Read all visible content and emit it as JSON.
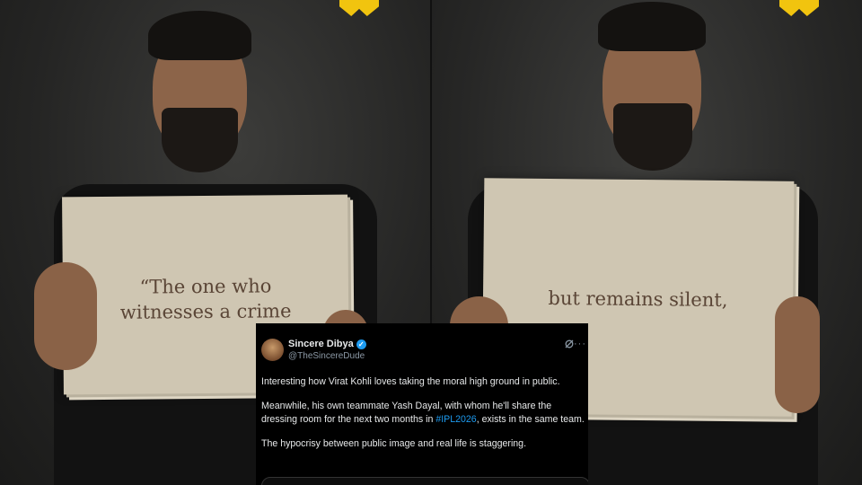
{
  "left_card": {
    "line1": "“The one who",
    "line2": "witnesses a crime"
  },
  "right_card": {
    "line1": "but remains silent,"
  },
  "tweet": {
    "author_name": "Sincere Dibya",
    "author_handle": "@TheSincereDude",
    "paragraph1": "Interesting how Virat Kohli loves taking the moral high ground in public.",
    "paragraph2_before": "Meanwhile, his own teammate Yash Dayal, with whom he'll share the dressing room for the next two months in ",
    "hashtag": "#IPL2026",
    "paragraph2_after": ", exists in the same team.",
    "paragraph3": "The hypocrisy between public image and real life is staggering.",
    "more_label": "···"
  },
  "colors": {
    "logo": "#f1c40f",
    "card": "#cfc6b2",
    "card_text": "#5a4536",
    "link": "#1d9bf0",
    "tweet_bg": "#000000"
  }
}
